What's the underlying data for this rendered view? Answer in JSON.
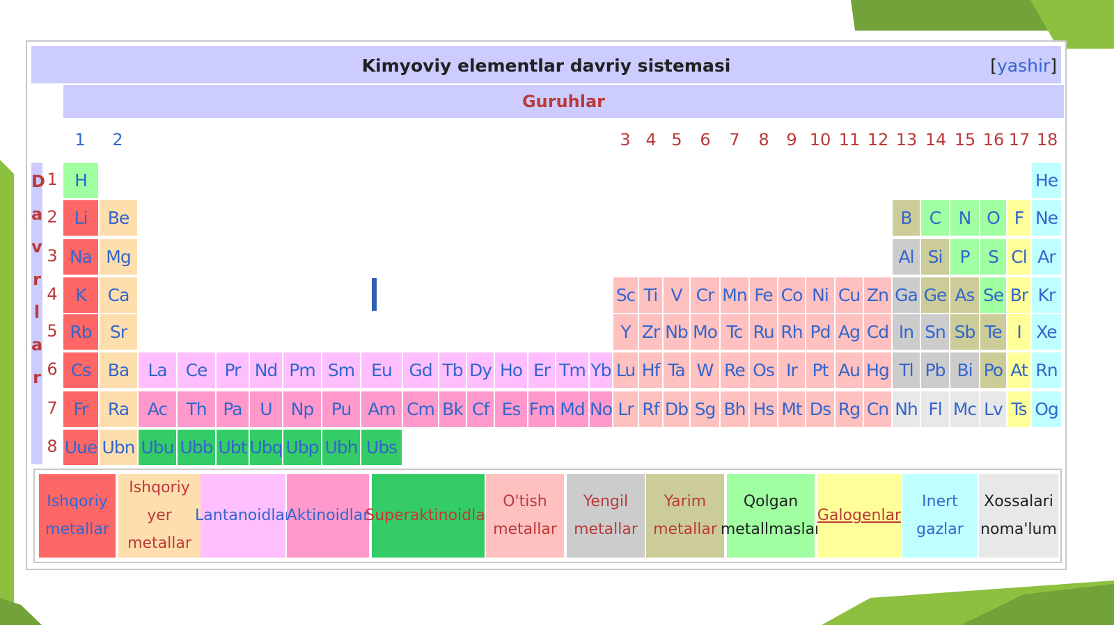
{
  "title": "Kimyoviy elementlar davriy sistemasi",
  "hide_link": {
    "open": "[",
    "label": "yashir",
    "close": "]"
  },
  "groups_label": "Guruhlar",
  "periods_label": "Davrlar",
  "groups": [
    "1",
    "2",
    "3",
    "4",
    "5",
    "6",
    "7",
    "8",
    "9",
    "10",
    "11",
    "12",
    "13",
    "14",
    "15",
    "16",
    "17",
    "18"
  ],
  "periods": [
    "1",
    "2",
    "3",
    "4",
    "5",
    "6",
    "7",
    "8"
  ],
  "colors": {
    "alkali": "#ff6666",
    "alkaline": "#ffdead",
    "lanthanide": "#ffbfff",
    "actinide": "#ff99cc",
    "superactinide": "#33cc66",
    "transition": "#ffc0c0",
    "posttransition": "#cccccc",
    "metalloid": "#cccc99",
    "nonmetal": "#a0ffa0",
    "halogen": "#ffff99",
    "noble": "#c0ffff",
    "unknown": "#e8e8e8"
  },
  "elements": [
    {
      "s": "H",
      "c": "nonmetal",
      "col": "c1",
      "row": "p1"
    },
    {
      "s": "He",
      "c": "noble",
      "col": "g18",
      "row": "p1"
    },
    {
      "s": "Li",
      "c": "alkali",
      "col": "c1",
      "row": "p2"
    },
    {
      "s": "Be",
      "c": "alkaline",
      "col": "c2",
      "row": "p2"
    },
    {
      "s": "B",
      "c": "metalloid",
      "col": "g13",
      "row": "p2"
    },
    {
      "s": "C",
      "c": "nonmetal",
      "col": "g14",
      "row": "p2"
    },
    {
      "s": "N",
      "c": "nonmetal",
      "col": "g15",
      "row": "p2"
    },
    {
      "s": "O",
      "c": "nonmetal",
      "col": "g16",
      "row": "p2"
    },
    {
      "s": "F",
      "c": "halogen",
      "col": "g17",
      "row": "p2"
    },
    {
      "s": "Ne",
      "c": "noble",
      "col": "g18",
      "row": "p2"
    },
    {
      "s": "Na",
      "c": "alkali",
      "col": "c1",
      "row": "p3"
    },
    {
      "s": "Mg",
      "c": "alkaline",
      "col": "c2",
      "row": "p3"
    },
    {
      "s": "Al",
      "c": "posttransition",
      "col": "g13",
      "row": "p3"
    },
    {
      "s": "Si",
      "c": "metalloid",
      "col": "g14",
      "row": "p3"
    },
    {
      "s": "P",
      "c": "nonmetal",
      "col": "g15",
      "row": "p3"
    },
    {
      "s": "S",
      "c": "nonmetal",
      "col": "g16",
      "row": "p3"
    },
    {
      "s": "Cl",
      "c": "halogen",
      "col": "g17",
      "row": "p3"
    },
    {
      "s": "Ar",
      "c": "noble",
      "col": "g18",
      "row": "p3"
    },
    {
      "s": "K",
      "c": "alkali",
      "col": "c1",
      "row": "p4"
    },
    {
      "s": "Ca",
      "c": "alkaline",
      "col": "c2",
      "row": "p4"
    },
    {
      "s": "Sc",
      "c": "transition",
      "col": "g3",
      "row": "p4"
    },
    {
      "s": "Ti",
      "c": "transition",
      "col": "g4",
      "row": "p4"
    },
    {
      "s": "V",
      "c": "transition",
      "col": "g5",
      "row": "p4"
    },
    {
      "s": "Cr",
      "c": "transition",
      "col": "g6",
      "row": "p4"
    },
    {
      "s": "Mn",
      "c": "transition",
      "col": "g7",
      "row": "p4"
    },
    {
      "s": "Fe",
      "c": "transition",
      "col": "g8",
      "row": "p4"
    },
    {
      "s": "Co",
      "c": "transition",
      "col": "g9",
      "row": "p4"
    },
    {
      "s": "Ni",
      "c": "transition",
      "col": "g10",
      "row": "p4"
    },
    {
      "s": "Cu",
      "c": "transition",
      "col": "g11",
      "row": "p4"
    },
    {
      "s": "Zn",
      "c": "transition",
      "col": "g12",
      "row": "p4"
    },
    {
      "s": "Ga",
      "c": "posttransition",
      "col": "g13",
      "row": "p4"
    },
    {
      "s": "Ge",
      "c": "metalloid",
      "col": "g14",
      "row": "p4"
    },
    {
      "s": "As",
      "c": "metalloid",
      "col": "g15",
      "row": "p4"
    },
    {
      "s": "Se",
      "c": "nonmetal",
      "col": "g16",
      "row": "p4"
    },
    {
      "s": "Br",
      "c": "halogen",
      "col": "g17",
      "row": "p4"
    },
    {
      "s": "Kr",
      "c": "noble",
      "col": "g18",
      "row": "p4"
    },
    {
      "s": "Rb",
      "c": "alkali",
      "col": "c1",
      "row": "p5"
    },
    {
      "s": "Sr",
      "c": "alkaline",
      "col": "c2",
      "row": "p5"
    },
    {
      "s": "Y",
      "c": "transition",
      "col": "g3",
      "row": "p5"
    },
    {
      "s": "Zr",
      "c": "transition",
      "col": "g4",
      "row": "p5"
    },
    {
      "s": "Nb",
      "c": "transition",
      "col": "g5",
      "row": "p5"
    },
    {
      "s": "Mo",
      "c": "transition",
      "col": "g6",
      "row": "p5"
    },
    {
      "s": "Tc",
      "c": "transition",
      "col": "g7",
      "row": "p5"
    },
    {
      "s": "Ru",
      "c": "transition",
      "col": "g8",
      "row": "p5"
    },
    {
      "s": "Rh",
      "c": "transition",
      "col": "g9",
      "row": "p5"
    },
    {
      "s": "Pd",
      "c": "transition",
      "col": "g10",
      "row": "p5"
    },
    {
      "s": "Ag",
      "c": "transition",
      "col": "g11",
      "row": "p5"
    },
    {
      "s": "Cd",
      "c": "transition",
      "col": "g12",
      "row": "p5"
    },
    {
      "s": "In",
      "c": "posttransition",
      "col": "g13",
      "row": "p5"
    },
    {
      "s": "Sn",
      "c": "posttransition",
      "col": "g14",
      "row": "p5"
    },
    {
      "s": "Sb",
      "c": "metalloid",
      "col": "g15",
      "row": "p5"
    },
    {
      "s": "Te",
      "c": "metalloid",
      "col": "g16",
      "row": "p5"
    },
    {
      "s": "I",
      "c": "halogen",
      "col": "g17",
      "row": "p5"
    },
    {
      "s": "Xe",
      "c": "noble",
      "col": "g18",
      "row": "p5"
    },
    {
      "s": "Cs",
      "c": "alkali",
      "col": "c1",
      "row": "p6"
    },
    {
      "s": "Ba",
      "c": "alkaline",
      "col": "c2",
      "row": "p6"
    },
    {
      "s": "La",
      "c": "lanthanide",
      "col": "f1",
      "row": "p6"
    },
    {
      "s": "Ce",
      "c": "lanthanide",
      "col": "f2",
      "row": "p6"
    },
    {
      "s": "Pr",
      "c": "lanthanide",
      "col": "f3",
      "row": "p6"
    },
    {
      "s": "Nd",
      "c": "lanthanide",
      "col": "f4",
      "row": "p6"
    },
    {
      "s": "Pm",
      "c": "lanthanide",
      "col": "f5",
      "row": "p6"
    },
    {
      "s": "Sm",
      "c": "lanthanide",
      "col": "f6",
      "row": "p6"
    },
    {
      "s": "Eu",
      "c": "lanthanide",
      "col": "f7",
      "row": "p6"
    },
    {
      "s": "Gd",
      "c": "lanthanide",
      "col": "f8",
      "row": "p6"
    },
    {
      "s": "Tb",
      "c": "lanthanide",
      "col": "f9",
      "row": "p6"
    },
    {
      "s": "Dy",
      "c": "lanthanide",
      "col": "f10",
      "row": "p6"
    },
    {
      "s": "Ho",
      "c": "lanthanide",
      "col": "f11",
      "row": "p6"
    },
    {
      "s": "Er",
      "c": "lanthanide",
      "col": "f12",
      "row": "p6"
    },
    {
      "s": "Tm",
      "c": "lanthanide",
      "col": "f13",
      "row": "p6"
    },
    {
      "s": "Yb",
      "c": "lanthanide",
      "col": "f14",
      "row": "p6"
    },
    {
      "s": "Lu",
      "c": "transition",
      "col": "g3",
      "row": "p6"
    },
    {
      "s": "Hf",
      "c": "transition",
      "col": "g4",
      "row": "p6"
    },
    {
      "s": "Ta",
      "c": "transition",
      "col": "g5",
      "row": "p6"
    },
    {
      "s": "W",
      "c": "transition",
      "col": "g6",
      "row": "p6"
    },
    {
      "s": "Re",
      "c": "transition",
      "col": "g7",
      "row": "p6"
    },
    {
      "s": "Os",
      "c": "transition",
      "col": "g8",
      "row": "p6"
    },
    {
      "s": "Ir",
      "c": "transition",
      "col": "g9",
      "row": "p6"
    },
    {
      "s": "Pt",
      "c": "transition",
      "col": "g10",
      "row": "p6"
    },
    {
      "s": "Au",
      "c": "transition",
      "col": "g11",
      "row": "p6"
    },
    {
      "s": "Hg",
      "c": "transition",
      "col": "g12",
      "row": "p6"
    },
    {
      "s": "Tl",
      "c": "posttransition",
      "col": "g13",
      "row": "p6"
    },
    {
      "s": "Pb",
      "c": "posttransition",
      "col": "g14",
      "row": "p6"
    },
    {
      "s": "Bi",
      "c": "posttransition",
      "col": "g15",
      "row": "p6"
    },
    {
      "s": "Po",
      "c": "metalloid",
      "col": "g16",
      "row": "p6"
    },
    {
      "s": "At",
      "c": "halogen",
      "col": "g17",
      "row": "p6"
    },
    {
      "s": "Rn",
      "c": "noble",
      "col": "g18",
      "row": "p6"
    },
    {
      "s": "Fr",
      "c": "alkali",
      "col": "c1",
      "row": "p7"
    },
    {
      "s": "Ra",
      "c": "alkaline",
      "col": "c2",
      "row": "p7"
    },
    {
      "s": "Ac",
      "c": "actinide",
      "col": "f1",
      "row": "p7"
    },
    {
      "s": "Th",
      "c": "actinide",
      "col": "f2",
      "row": "p7"
    },
    {
      "s": "Pa",
      "c": "actinide",
      "col": "f3",
      "row": "p7"
    },
    {
      "s": "U",
      "c": "actinide",
      "col": "f4",
      "row": "p7"
    },
    {
      "s": "Np",
      "c": "actinide",
      "col": "f5",
      "row": "p7"
    },
    {
      "s": "Pu",
      "c": "actinide",
      "col": "f6",
      "row": "p7"
    },
    {
      "s": "Am",
      "c": "actinide",
      "col": "f7",
      "row": "p7"
    },
    {
      "s": "Cm",
      "c": "actinide",
      "col": "f8",
      "row": "p7"
    },
    {
      "s": "Bk",
      "c": "actinide",
      "col": "f9",
      "row": "p7"
    },
    {
      "s": "Cf",
      "c": "actinide",
      "col": "f10",
      "row": "p7"
    },
    {
      "s": "Es",
      "c": "actinide",
      "col": "f11",
      "row": "p7"
    },
    {
      "s": "Fm",
      "c": "actinide",
      "col": "f12",
      "row": "p7"
    },
    {
      "s": "Md",
      "c": "actinide",
      "col": "f13",
      "row": "p7"
    },
    {
      "s": "No",
      "c": "actinide",
      "col": "f14",
      "row": "p7"
    },
    {
      "s": "Lr",
      "c": "transition",
      "col": "g3",
      "row": "p7"
    },
    {
      "s": "Rf",
      "c": "transition",
      "col": "g4",
      "row": "p7"
    },
    {
      "s": "Db",
      "c": "transition",
      "col": "g5",
      "row": "p7"
    },
    {
      "s": "Sg",
      "c": "transition",
      "col": "g6",
      "row": "p7"
    },
    {
      "s": "Bh",
      "c": "transition",
      "col": "g7",
      "row": "p7"
    },
    {
      "s": "Hs",
      "c": "transition",
      "col": "g8",
      "row": "p7"
    },
    {
      "s": "Mt",
      "c": "transition",
      "col": "g9",
      "row": "p7"
    },
    {
      "s": "Ds",
      "c": "transition",
      "col": "g10",
      "row": "p7"
    },
    {
      "s": "Rg",
      "c": "transition",
      "col": "g11",
      "row": "p7"
    },
    {
      "s": "Cn",
      "c": "transition",
      "col": "g12",
      "row": "p7"
    },
    {
      "s": "Nh",
      "c": "unknown",
      "col": "g13",
      "row": "p7"
    },
    {
      "s": "Fl",
      "c": "unknown",
      "col": "g14",
      "row": "p7"
    },
    {
      "s": "Mc",
      "c": "unknown",
      "col": "g15",
      "row": "p7"
    },
    {
      "s": "Lv",
      "c": "unknown",
      "col": "g16",
      "row": "p7"
    },
    {
      "s": "Ts",
      "c": "halogen",
      "col": "g17",
      "row": "p7"
    },
    {
      "s": "Og",
      "c": "noble",
      "col": "g18",
      "row": "p7"
    },
    {
      "s": "Uue",
      "c": "alkali",
      "col": "c1",
      "row": "p8"
    },
    {
      "s": "Ubn",
      "c": "alkaline",
      "col": "c2",
      "row": "p8"
    },
    {
      "s": "Ubu",
      "c": "superactinide",
      "col": "f1",
      "row": "p8"
    },
    {
      "s": "Ubb",
      "c": "superactinide",
      "col": "f2",
      "row": "p8"
    },
    {
      "s": "Ubt",
      "c": "superactinide",
      "col": "f3",
      "row": "p8"
    },
    {
      "s": "Ubq",
      "c": "superactinide",
      "col": "f4",
      "row": "p8"
    },
    {
      "s": "Ubp",
      "c": "superactinide",
      "col": "f5",
      "row": "p8"
    },
    {
      "s": "Ubh",
      "c": "superactinide",
      "col": "f6",
      "row": "p8"
    },
    {
      "s": "Ubs",
      "c": "superactinide",
      "col": "f7",
      "row": "p8"
    }
  ],
  "legend": [
    {
      "key": "alkali",
      "lines": [
        "Ishqoriy",
        "metallar"
      ],
      "text_color": "#3366cc"
    },
    {
      "key": "alkaline",
      "lines": [
        "Ishqoriy",
        "yer",
        "metallar"
      ],
      "text_color": "#ba3a3a"
    },
    {
      "key": "lanthanide",
      "lines": [
        "Lantanoidlar"
      ],
      "text_color": "#3366cc"
    },
    {
      "key": "actinide",
      "lines": [
        "Aktinoidlar"
      ],
      "text_color": "#3366cc"
    },
    {
      "key": "superactinide",
      "lines": [
        "Superaktinoidlar"
      ],
      "text_color": "#cc3333"
    },
    {
      "key": "transition",
      "lines": [
        "O'tish",
        "metallar"
      ],
      "text_color": "#ba3a3a"
    },
    {
      "key": "posttransition",
      "lines": [
        "Yengil",
        "metallar"
      ],
      "text_color": "#ba3a3a"
    },
    {
      "key": "metalloid",
      "lines": [
        "Yarim",
        "metallar"
      ],
      "text_color": "#ba3a3a"
    },
    {
      "key": "nonmetal",
      "lines": [
        "Qolgan",
        "metallmaslar"
      ],
      "text_color": "#202122"
    },
    {
      "key": "halogen",
      "lines": [
        "Galogenlar"
      ],
      "text_color": "#ba3a3a"
    },
    {
      "key": "noble",
      "lines": [
        "Inert",
        "gazlar"
      ],
      "text_color": "#3366cc"
    },
    {
      "key": "unknown",
      "lines": [
        "Xossalari",
        "noma'lum"
      ],
      "text_color": "#202122"
    }
  ]
}
